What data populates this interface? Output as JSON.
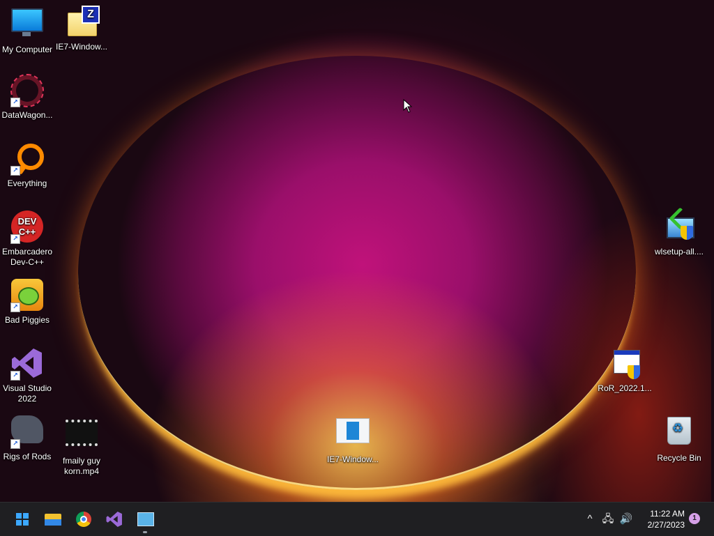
{
  "desktop": {
    "icons": [
      {
        "id": "my-computer",
        "label": "My Computer"
      },
      {
        "id": "ie7-window-folder",
        "label": "IE7-Window..."
      },
      {
        "id": "datawagon",
        "label": "DataWagon..."
      },
      {
        "id": "everything",
        "label": "Everything"
      },
      {
        "id": "devcpp",
        "label": "Embarcadero Dev-C++"
      },
      {
        "id": "bad-piggies",
        "label": "Bad Piggies"
      },
      {
        "id": "visual-studio",
        "label": "Visual Studio 2022"
      },
      {
        "id": "rigs-of-rods",
        "label": "Rigs of Rods"
      },
      {
        "id": "family-guy",
        "label": "fmaily guy korn.mp4"
      },
      {
        "id": "ie7-window-center",
        "label": "IE7-Window..."
      },
      {
        "id": "wlsetup",
        "label": "wlsetup-all...."
      },
      {
        "id": "ror",
        "label": "RoR_2022.1..."
      },
      {
        "id": "recycle-bin",
        "label": "Recycle Bin"
      }
    ],
    "devcpp_badge": "DEV\nC++",
    "zip_badge": "Z"
  },
  "taskbar": {
    "apps": [
      {
        "name": "start-icon"
      },
      {
        "name": "file-explorer-icon"
      },
      {
        "name": "chrome-icon"
      },
      {
        "name": "visual-studio-icon"
      },
      {
        "name": "screen-recorder-icon"
      }
    ],
    "tray": {
      "chevron": "^",
      "time": "11:22 AM",
      "date": "2/27/2023",
      "notifications": "1"
    }
  }
}
